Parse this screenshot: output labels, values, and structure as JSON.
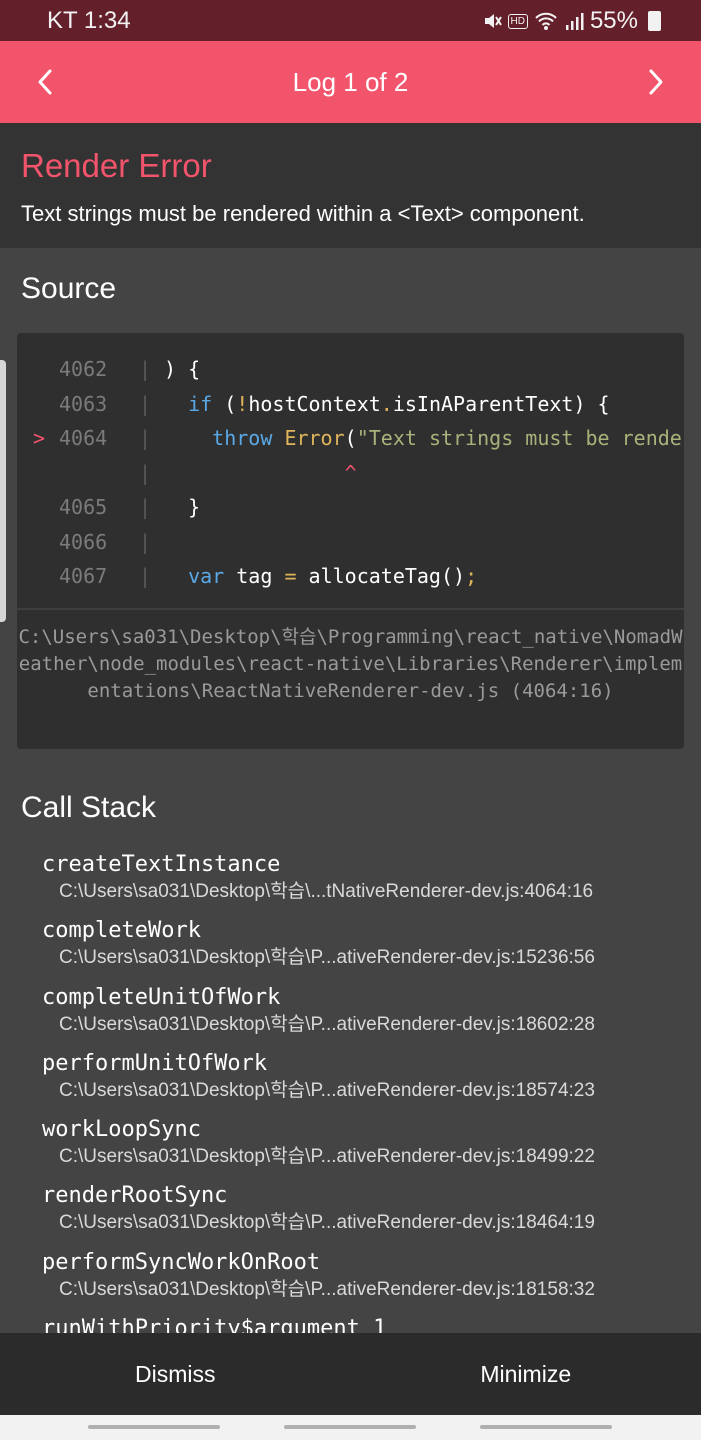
{
  "status_bar": {
    "carrier_time": "KT 1:34",
    "hd_label": "HD",
    "battery": "55%"
  },
  "header": {
    "title": "Log 1 of 2",
    "prev_icon": "chevron-left-icon",
    "next_icon": "chevron-right-icon"
  },
  "error": {
    "title": "Render Error",
    "message": "Text strings must be rendered within a <Text> component."
  },
  "source": {
    "title": "Source",
    "lines": [
      {
        "num": "4062",
        "marker": "",
        "tokens": [
          {
            "t": ") {",
            "c": ""
          }
        ]
      },
      {
        "num": "4063",
        "marker": "",
        "tokens": [
          {
            "t": "  ",
            "c": ""
          },
          {
            "t": "if",
            "c": "kw"
          },
          {
            "t": " (",
            "c": ""
          },
          {
            "t": "!",
            "c": "fn"
          },
          {
            "t": "hostContext",
            "c": ""
          },
          {
            "t": ".",
            "c": "fn"
          },
          {
            "t": "isInAParentText) {",
            "c": ""
          }
        ]
      },
      {
        "num": "4064",
        "marker": ">",
        "tokens": [
          {
            "t": "    ",
            "c": ""
          },
          {
            "t": "throw",
            "c": "kw"
          },
          {
            "t": " ",
            "c": ""
          },
          {
            "t": "Error",
            "c": "fn"
          },
          {
            "t": "(",
            "c": ""
          },
          {
            "t": "\"Text strings must be rende",
            "c": "str"
          }
        ]
      },
      {
        "num": "",
        "marker": "",
        "tokens": [
          {
            "t": "               ",
            "c": ""
          },
          {
            "t": "^",
            "c": "caret"
          }
        ]
      },
      {
        "num": "4065",
        "marker": "",
        "tokens": [
          {
            "t": "  }",
            "c": ""
          }
        ]
      },
      {
        "num": "4066",
        "marker": "",
        "tokens": [
          {
            "t": "",
            "c": ""
          }
        ]
      },
      {
        "num": "4067",
        "marker": "",
        "tokens": [
          {
            "t": "  ",
            "c": ""
          },
          {
            "t": "var",
            "c": "kw"
          },
          {
            "t": " tag ",
            "c": ""
          },
          {
            "t": "=",
            "c": "fn"
          },
          {
            "t": " allocateTag()",
            "c": ""
          },
          {
            "t": ";",
            "c": "fn"
          }
        ]
      }
    ],
    "file_path": "C:\\Users\\sa031\\Desktop\\학습\\Programming\\react_native\\NomadWeather\\node_modules\\react-native\\Libraries\\Renderer\\implementations\\ReactNativeRenderer-dev.js (4064:16)"
  },
  "call_stack": {
    "title": "Call Stack",
    "frames": [
      {
        "name": "createTextInstance",
        "location": "C:\\Users\\sa031\\Desktop\\학습\\...tNativeRenderer-dev.js:4064:16"
      },
      {
        "name": "completeWork",
        "location": "C:\\Users\\sa031\\Desktop\\학습\\P...ativeRenderer-dev.js:15236:56"
      },
      {
        "name": "completeUnitOfWork",
        "location": "C:\\Users\\sa031\\Desktop\\학습\\P...ativeRenderer-dev.js:18602:28"
      },
      {
        "name": "performUnitOfWork",
        "location": "C:\\Users\\sa031\\Desktop\\학습\\P...ativeRenderer-dev.js:18574:23"
      },
      {
        "name": "workLoopSync",
        "location": "C:\\Users\\sa031\\Desktop\\학습\\P...ativeRenderer-dev.js:18499:22"
      },
      {
        "name": "renderRootSync",
        "location": "C:\\Users\\sa031\\Desktop\\학습\\P...ativeRenderer-dev.js:18464:19"
      },
      {
        "name": "performSyncWorkOnRoot",
        "location": "C:\\Users\\sa031\\Desktop\\학습\\P...ativeRenderer-dev.js:18158:32"
      },
      {
        "name": "runWithPriority$argument_1",
        "location": ""
      }
    ]
  },
  "footer": {
    "dismiss_label": "Dismiss",
    "minimize_label": "Minimize"
  }
}
